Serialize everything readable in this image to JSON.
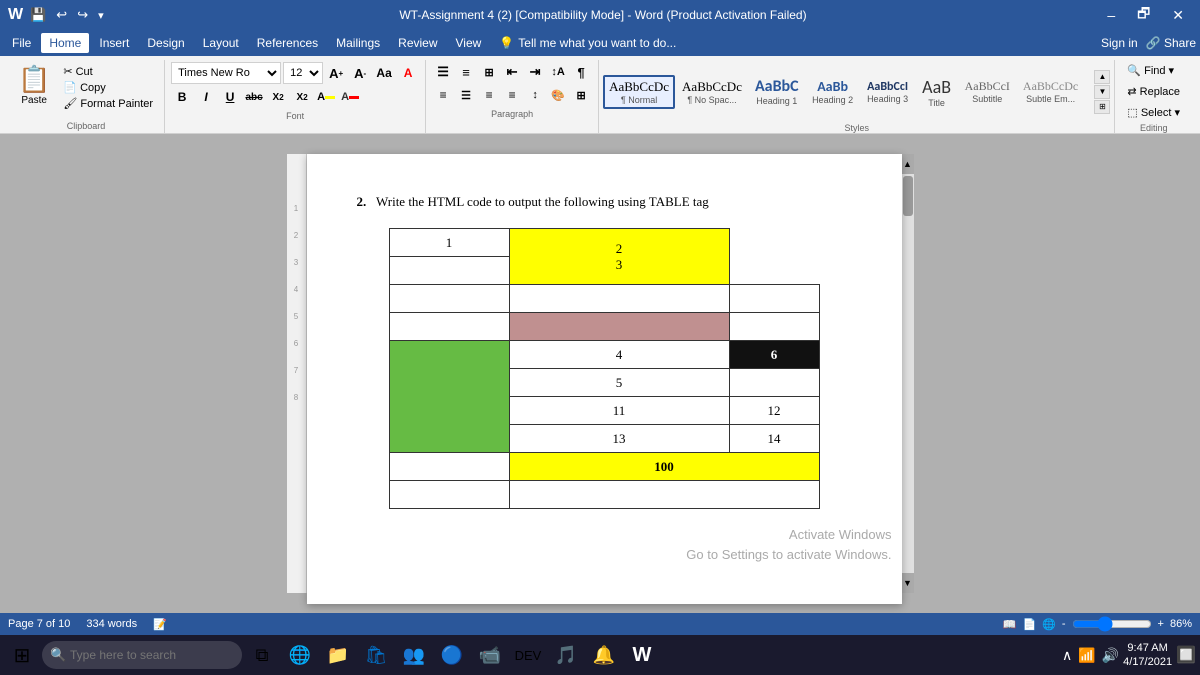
{
  "titlebar": {
    "title": "WT-Assignment 4 (2) [Compatibility Mode] - Word (Product Activation Failed)",
    "minimize": "–",
    "restore": "🗗",
    "close": "✕"
  },
  "menu": {
    "items": [
      "File",
      "Home",
      "Insert",
      "Design",
      "Layout",
      "References",
      "Mailings",
      "Review",
      "View",
      "Tell me what you want to do..."
    ]
  },
  "ribbon": {
    "clipboard": {
      "group_label": "Clipboard",
      "paste_label": "Paste",
      "cut_label": "Cut",
      "copy_label": "Copy",
      "format_painter_label": "Format Painter"
    },
    "font": {
      "group_label": "Font",
      "font_name": "Times New Ro",
      "font_size": "12",
      "bold": "B",
      "italic": "I",
      "underline": "U",
      "strikethrough": "abc",
      "subscript": "X₂",
      "superscript": "X²"
    },
    "paragraph": {
      "group_label": "Paragraph"
    },
    "styles": {
      "group_label": "Styles",
      "items": [
        {
          "label": "¶ Normal",
          "style": "normal",
          "active": true
        },
        {
          "label": "¶ No Spac...",
          "style": "no-spacing"
        },
        {
          "label": "Heading 1",
          "style": "heading1"
        },
        {
          "label": "Heading 2",
          "style": "heading2"
        },
        {
          "label": "Heading 3",
          "style": "heading3"
        },
        {
          "label": "Title",
          "style": "title"
        },
        {
          "label": "Subtitle",
          "style": "subtitle"
        },
        {
          "label": "Subtle Em...",
          "style": "subtle-em"
        }
      ]
    },
    "editing": {
      "group_label": "Editing",
      "find_label": "Find",
      "replace_label": "Replace",
      "select_label": "Select ▾"
    }
  },
  "document": {
    "question_number": "2.",
    "question_text": "Write the HTML code to output the following using TABLE tag",
    "table": {
      "rows": [
        {
          "cells": [
            {
              "text": "1",
              "colspan": 1,
              "rowspan": 1,
              "bg": "white",
              "color": "black",
              "bold": false
            },
            {
              "text": "2",
              "colspan": 1,
              "rowspan": 1,
              "bg": "#ffff00",
              "color": "black",
              "bold": false
            }
          ]
        },
        {
          "cells": [
            {
              "text": "",
              "colspan": 1,
              "rowspan": 1,
              "bg": "white",
              "color": "black"
            },
            {
              "text": "3",
              "colspan": 1,
              "rowspan": 1,
              "bg": "white",
              "color": "black"
            }
          ]
        },
        {
          "cells": [
            {
              "text": "",
              "colspan": 1,
              "rowspan": 1,
              "bg": "white"
            },
            {
              "text": "",
              "colspan": 1,
              "rowspan": 1,
              "bg": "white"
            },
            {
              "text": "",
              "colspan": 1,
              "rowspan": 1,
              "bg": "white"
            }
          ]
        },
        {
          "cells": [
            {
              "text": "",
              "colspan": 1,
              "rowspan": 1,
              "bg": "white"
            },
            {
              "text": "",
              "colspan": 1,
              "rowspan": 1,
              "bg": "#c09090"
            },
            {
              "text": "",
              "colspan": 1,
              "rowspan": 1,
              "bg": "white"
            }
          ]
        },
        {
          "cells": [
            {
              "text": "",
              "colspan": 1,
              "rowspan": 4,
              "bg": "#66bb44"
            },
            {
              "text": "4",
              "colspan": 1,
              "rowspan": 1,
              "bg": "white"
            },
            {
              "text": "6",
              "colspan": 1,
              "rowspan": 1,
              "bg": "#111111",
              "color": "white",
              "bold": false
            }
          ]
        },
        {
          "cells": [
            {
              "text": "5",
              "colspan": 1,
              "rowspan": 1,
              "bg": "white"
            },
            {
              "text": "",
              "colspan": 1,
              "rowspan": 1,
              "bg": "white"
            }
          ]
        },
        {
          "cells": [
            {
              "text": "11",
              "colspan": 1,
              "rowspan": 1,
              "bg": "white"
            },
            {
              "text": "12",
              "colspan": 1,
              "rowspan": 1,
              "bg": "white"
            }
          ]
        },
        {
          "cells": [
            {
              "text": "13",
              "colspan": 1,
              "rowspan": 1,
              "bg": "white"
            },
            {
              "text": "14",
              "colspan": 1,
              "rowspan": 1,
              "bg": "white"
            }
          ]
        },
        {
          "cells": [
            {
              "text": "100",
              "colspan": 2,
              "rowspan": 1,
              "bg": "#ffff00",
              "bold": true
            }
          ]
        },
        {
          "cells": [
            {
              "text": "",
              "colspan": 2,
              "rowspan": 1,
              "bg": "white"
            }
          ]
        }
      ]
    }
  },
  "statusbar": {
    "page_info": "Page 7 of 10",
    "word_count": "334 words",
    "zoom_level": "86%"
  },
  "taskbar": {
    "search_placeholder": "Type here to search",
    "time": "9:47 AM",
    "date": "4/17/2021"
  },
  "watermark": {
    "line1": "Activate Windows",
    "line2": "Go to Settings to activate Windows."
  }
}
